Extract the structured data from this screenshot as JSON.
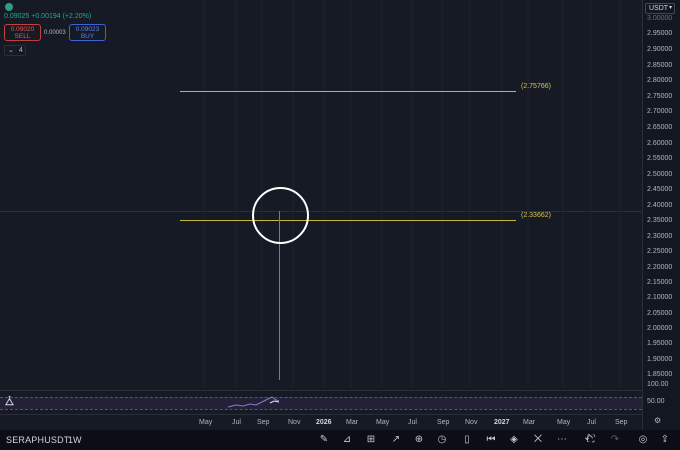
{
  "header": {
    "quote": "0.09025 +0.00194 (+2.20%)",
    "sell_price": "0.09020",
    "sell_label": "SELL",
    "spread": "0.00003",
    "buy_price": "0.09023",
    "buy_label": "BUY",
    "indicators_count": "4"
  },
  "price_axis": {
    "currency": "USDT",
    "ticks": [
      "3.00000",
      "2.95000",
      "2.90000",
      "2.85000",
      "2.80000",
      "2.75000",
      "2.70000",
      "2.65000",
      "2.60000",
      "2.55000",
      "2.50000",
      "2.45000",
      "2.40000",
      "2.35000",
      "2.30000",
      "2.25000",
      "2.20000",
      "2.15000",
      "2.10000",
      "2.05000",
      "2.00000",
      "1.95000",
      "1.90000",
      "1.85000"
    ],
    "rsi_ticks": [
      "100.00",
      "50.00"
    ]
  },
  "lines": {
    "upper_label": "(2.75766)",
    "lower_label": "(2.33662)"
  },
  "time_axis": {
    "labels": [
      "May",
      "Jul",
      "Sep",
      "Nov",
      "2026",
      "Mar",
      "May",
      "Jul",
      "Sep",
      "Nov",
      "2027",
      "Mar",
      "May",
      "Jul",
      "Sep"
    ]
  },
  "toolbar": {
    "symbol": "SERAPHUSDT",
    "interval": "1W"
  },
  "colors": {
    "background": "#161a25",
    "horizontal_line": "#c8b73a",
    "candle": "#e0524f",
    "rsi": "#7e57c2",
    "up": "#26a69a"
  },
  "icons": [
    "logo-dot-icon",
    "chevron-down-icon",
    "tradingview-logo-icon",
    "gear-icon",
    "brush-icon",
    "chart-type-icon",
    "indicators-icon",
    "trend-line-icon",
    "add-icon",
    "alarm-icon",
    "candles-icon",
    "replay-icon",
    "layers-icon",
    "trash-icon",
    "more-icon",
    "undo-icon",
    "fullscreen-icon",
    "redo-icon",
    "screenshot-icon",
    "share-icon"
  ]
}
